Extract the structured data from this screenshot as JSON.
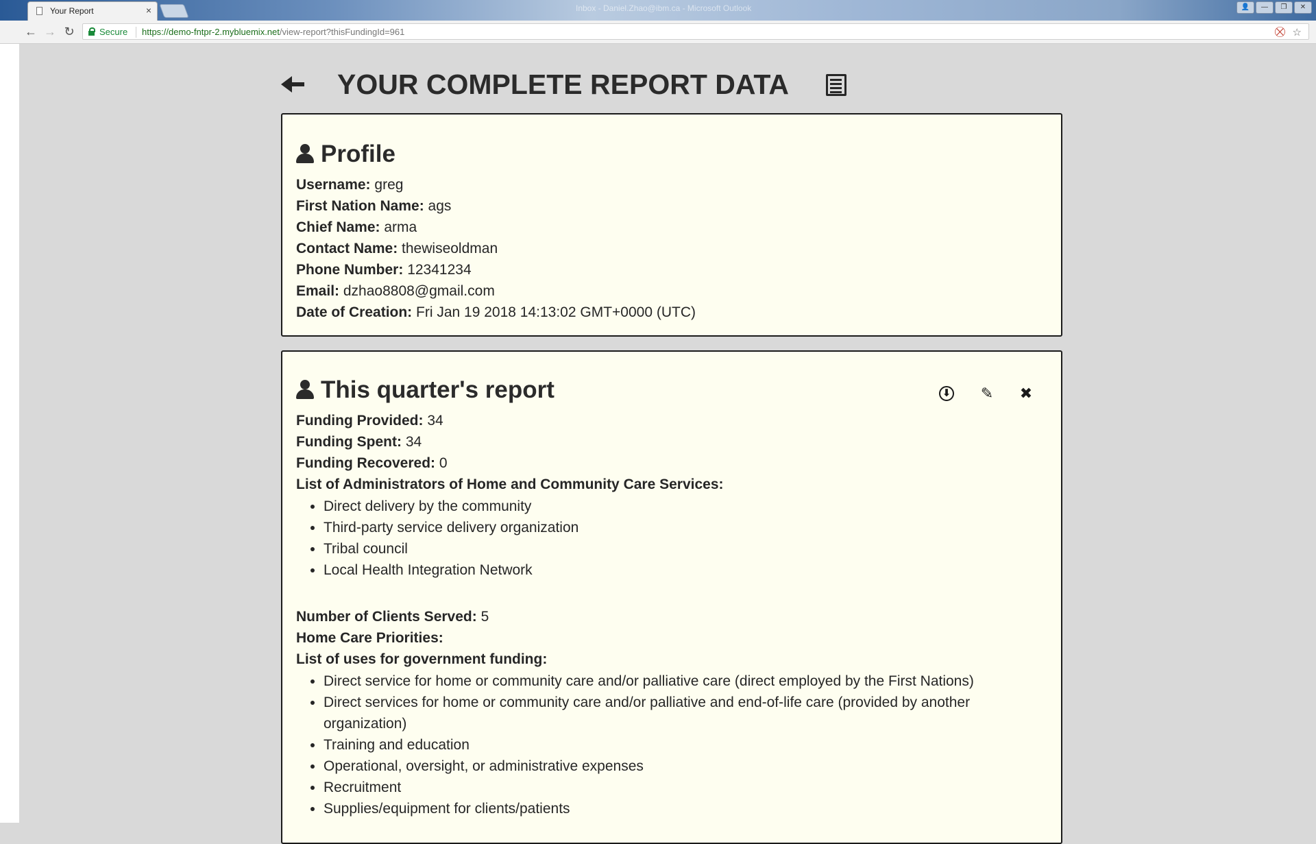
{
  "browser": {
    "tab_title": "Your Report",
    "tab_close": "×",
    "window_title": "Inbox - Daniel.Zhao@ibm.ca - Microsoft Outlook",
    "secure_label": "Secure",
    "url_scheme": "https://",
    "url_host": "demo-fntpr-2.mybluemix.net",
    "url_path": "/view-report?thisFundingId=961",
    "back_icon": "←",
    "forward_icon": "→",
    "reload_icon": "↻",
    "star_icon": "☆",
    "extension_icon": "⛒",
    "window_buttons": [
      "👤",
      "—",
      "❐",
      "✕"
    ]
  },
  "header": {
    "title": "YOUR COMPLETE REPORT DATA"
  },
  "profile": {
    "heading": "Profile",
    "fields": [
      {
        "label": "Username:",
        "value": "greg"
      },
      {
        "label": "First Nation Name:",
        "value": "ags"
      },
      {
        "label": "Chief Name:",
        "value": "arma"
      },
      {
        "label": "Contact Name:",
        "value": "thewiseoldman"
      },
      {
        "label": "Phone Number:",
        "value": "12341234"
      },
      {
        "label": "Email:",
        "value": "dzhao8808@gmail.com"
      },
      {
        "label": "Date of Creation:",
        "value": "Fri Jan 19 2018 14:13:02 GMT+0000 (UTC)"
      }
    ]
  },
  "report": {
    "heading": "This quarter's report",
    "actions": {
      "download": "⬇",
      "edit": "✎",
      "delete": "✖"
    },
    "funding_provided": {
      "label": "Funding Provided:",
      "value": "34"
    },
    "funding_spent": {
      "label": "Funding Spent:",
      "value": "34"
    },
    "funding_recovered": {
      "label": "Funding Recovered:",
      "value": "0"
    },
    "administrators_label": "List of Administrators of Home and Community Care Services:",
    "administrators": [
      "Direct delivery by the community",
      "Third-party service delivery organization",
      "Tribal council",
      "Local Health Integration Network"
    ],
    "clients_served": {
      "label": "Number of Clients Served:",
      "value": "5"
    },
    "priorities_label": "Home Care Priorities:",
    "uses_label": "List of uses for government funding:",
    "uses": [
      "Direct service for home or community care and/or palliative care (direct employed by the First Nations)",
      "Direct services for home or community care and/or palliative and end-of-life care (provided by another organization)",
      "Training and education",
      "Operational, oversight, or administrative expenses",
      "Recruitment",
      "Supplies/equipment for clients/patients"
    ]
  }
}
